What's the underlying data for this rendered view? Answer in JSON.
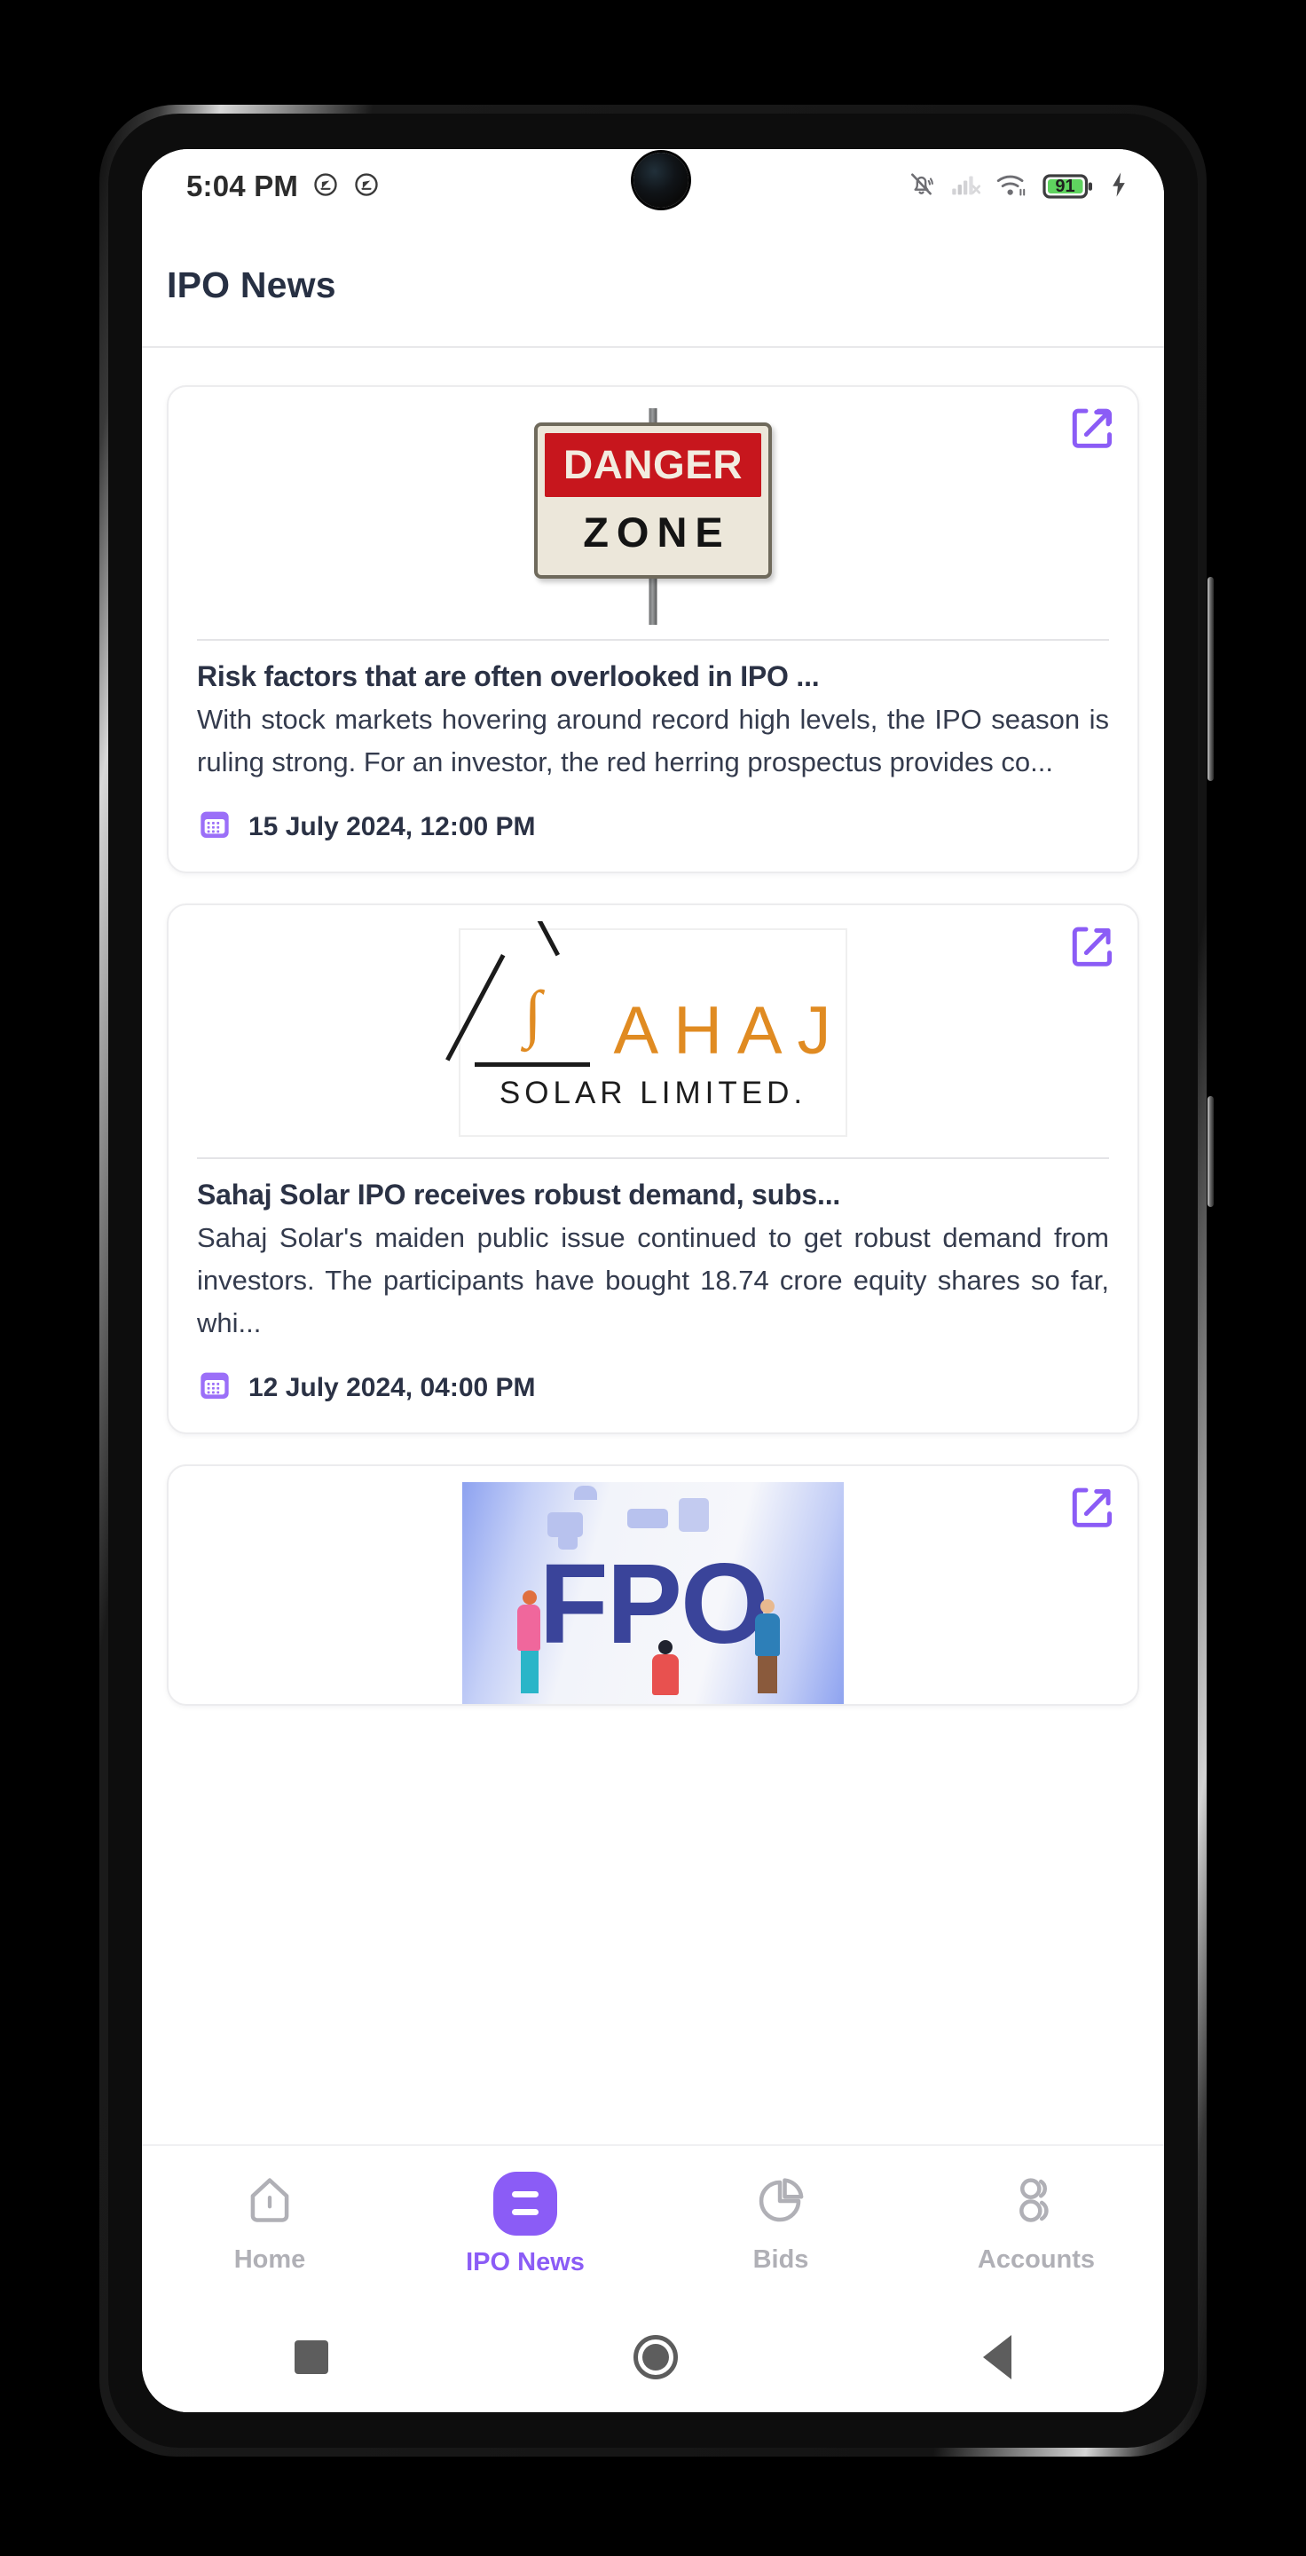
{
  "status_bar": {
    "time": "5:04 PM",
    "battery_percent": "91",
    "icons": [
      "silent-bell-icon",
      "cellular-signal-off-icon",
      "wifi-icon",
      "battery-icon",
      "charging-bolt-icon"
    ],
    "left_icons": [
      "do-not-disturb-icon",
      "do-not-disturb-icon"
    ]
  },
  "app_bar": {
    "title": "IPO News"
  },
  "news": [
    {
      "image_kind": "danger-zone-sign",
      "image_text_top": "DANGER",
      "image_text_bottom": "ZONE",
      "title": "Risk factors that are often overlooked in IPO ...",
      "description": "With stock markets hovering around record high levels, the IPO season is ruling strong. For an investor, the red herring prospectus provides co...",
      "date": "15 July 2024, 12:00 PM",
      "share_label": "Open article"
    },
    {
      "image_kind": "sahaj-solar-logo",
      "logo_letters": "A H A J",
      "logo_subtitle": "SOLAR LIMITED.",
      "title": "Sahaj Solar IPO receives robust demand, subs...",
      "description": "Sahaj Solar's maiden public issue continued to get robust demand from investors. The participants have bought 18.74 crore equity shares so far, whi...",
      "date": "12 July 2024, 04:00 PM",
      "share_label": "Open article"
    },
    {
      "image_kind": "fpo-illustration",
      "image_text": "FPO",
      "title": "",
      "description": "",
      "date": "",
      "share_label": "Open article"
    }
  ],
  "bottom_nav": {
    "items": [
      {
        "label": "Home",
        "icon": "home-icon",
        "active": false
      },
      {
        "label": "IPO News",
        "icon": "news-icon",
        "active": true
      },
      {
        "label": "Bids",
        "icon": "pie-chart-icon",
        "active": false
      },
      {
        "label": "Accounts",
        "icon": "people-icon",
        "active": false
      }
    ]
  },
  "android_nav": {
    "recents": "recents-button",
    "home": "home-button",
    "back": "back-button"
  },
  "colors": {
    "accent": "#8b5cf6",
    "title_text": "#2b3245",
    "muted_text": "#b0b0b6",
    "battery_green": "#5fd35f"
  }
}
